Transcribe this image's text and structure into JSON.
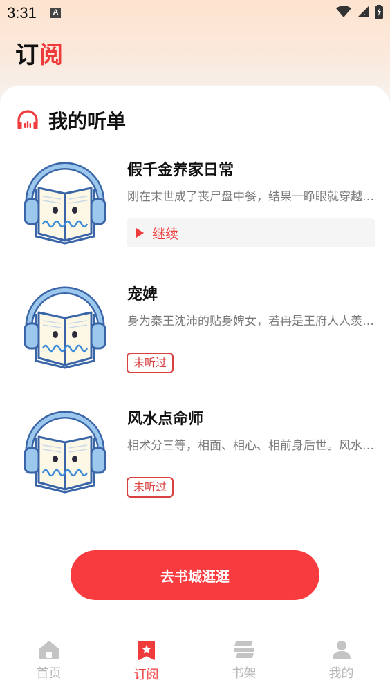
{
  "status_bar": {
    "time": "3:31",
    "notif_letter": "A"
  },
  "header": {
    "title_part1": "订",
    "title_part2": "阅"
  },
  "section": {
    "title": "我的听单"
  },
  "books": [
    {
      "title": "假千金养家日常",
      "desc": "刚在末世成了丧尸盘中餐，结果一睁眼就穿越到了一个陌生的地方",
      "action": "继续",
      "action_type": "continue"
    },
    {
      "title": "宠婢",
      "desc": "身为秦王沈沛的贴身婢女，若冉是王府人人羡慕的对象",
      "action": "未听过",
      "action_type": "badge"
    },
    {
      "title": "风水点命师",
      "desc": "相术分三等，相面、相心、相前身后世。风水之道",
      "action": "未听过",
      "action_type": "badge"
    }
  ],
  "cta": {
    "label": "去书城逛逛"
  },
  "tabs": [
    {
      "label": "首页",
      "icon": "home-icon",
      "active": false
    },
    {
      "label": "订阅",
      "icon": "bookmark-star-icon",
      "active": true
    },
    {
      "label": "书架",
      "icon": "bookshelf-icon",
      "active": false
    },
    {
      "label": "我的",
      "icon": "person-icon",
      "active": false
    }
  ],
  "colors": {
    "accent": "#ef3b3b",
    "cta": "#f73b3f",
    "inactive": "#b8b8b8"
  }
}
